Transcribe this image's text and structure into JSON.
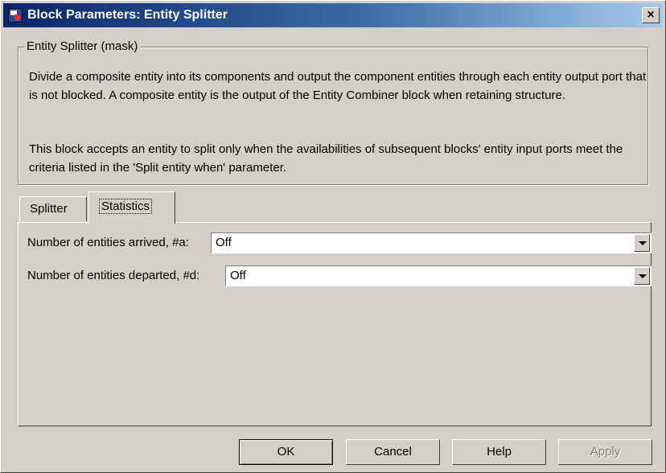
{
  "window": {
    "title": "Block Parameters: Entity Splitter",
    "close_glyph": "×"
  },
  "mask": {
    "group_title": "Entity Splitter (mask)",
    "description1": "Divide a composite entity into its components and output the component entities through each entity output port that is not blocked. A composite entity is the output of the Entity Combiner block when retaining structure.",
    "description2": "This block accepts an entity to split only when the availabilities of subsequent blocks' entity input ports meet the criteria listed in the 'Split entity when' parameter."
  },
  "tabs": [
    {
      "label": "Splitter",
      "selected": false
    },
    {
      "label": "Statistics",
      "selected": true
    }
  ],
  "fields": {
    "arrived": {
      "label": "Number of entities arrived, #a:",
      "value": "Off"
    },
    "departed": {
      "label": "Number of entities departed, #d:",
      "value": "Off"
    }
  },
  "buttons": {
    "ok": "OK",
    "cancel": "Cancel",
    "help": "Help",
    "apply": "Apply"
  },
  "colors": {
    "titlebar_start": "#0a246a",
    "titlebar_end": "#a6caf0",
    "face": "#d4d0c8"
  },
  "icons": {
    "app": "simulink-block-icon",
    "close": "close-icon",
    "dropdown": "chevron-down-icon"
  }
}
